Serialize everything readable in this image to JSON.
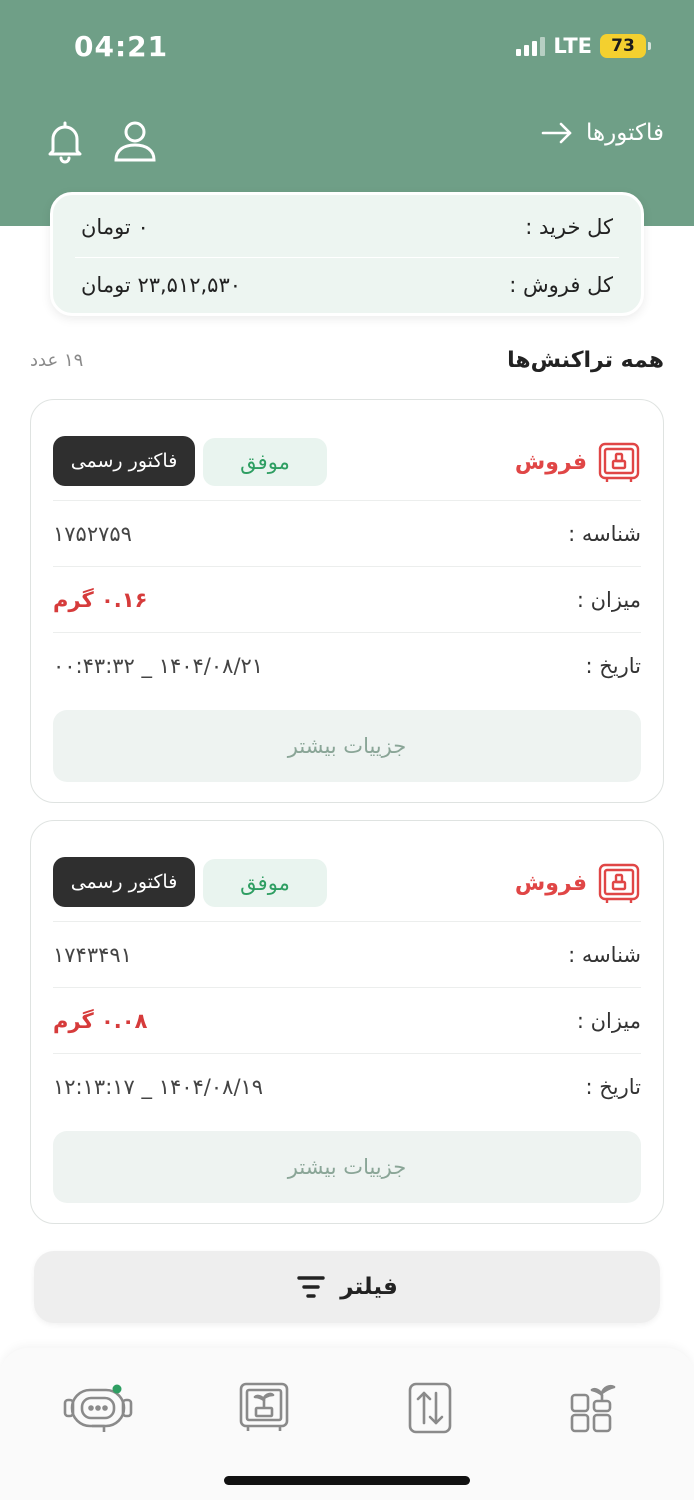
{
  "status_bar": {
    "time": "04:21",
    "network": "LTE",
    "battery": "73"
  },
  "header": {
    "title": "فاکتورها",
    "icons": [
      "bell-icon",
      "user-icon",
      "arrow-right-icon"
    ]
  },
  "summary": {
    "purchase_label": "کل خرید :",
    "purchase_value": "۰ تومان",
    "sales_label": "کل فروش :",
    "sales_value": "۲۳,۵۱۲,۵۳۰ تومان"
  },
  "section": {
    "title": "همه تراکنش‌ها",
    "count": "۱۹ عدد"
  },
  "transactions": [
    {
      "type": "فروش",
      "status": "موفق",
      "invoice_label": "فاکتور رسمی",
      "id_label": "شناسه :",
      "id_value": "۱۷۵۲۷۵۹",
      "amount_label": "میزان :",
      "amount_value": "۰.۱۶ گرم",
      "date_label": "تاریخ :",
      "date_value": "۱۴۰۴/۰۸/۲۱ _ ۰۰:۴۳:۳۲",
      "details_label": "جزییات بیشتر"
    },
    {
      "type": "فروش",
      "status": "موفق",
      "invoice_label": "فاکتور رسمی",
      "id_label": "شناسه :",
      "id_value": "۱۷۴۳۴۹۱",
      "amount_label": "میزان :",
      "amount_value": "۰.۰۸ گرم",
      "date_label": "تاریخ :",
      "date_value": "۱۴۰۴/۰۸/۱۹ _ ۱۲:۱۳:۱۷",
      "details_label": "جزییات بیشتر"
    }
  ],
  "filter": {
    "label": "فیلتر"
  },
  "bottom_nav": [
    "support-chat-icon",
    "safe-box-icon",
    "transfer-icon",
    "dashboard-icon"
  ],
  "colors": {
    "header": "#6f9f87",
    "sell": "#e04646",
    "success": "#2e9e62",
    "badge_dark": "#2f2f2f"
  }
}
